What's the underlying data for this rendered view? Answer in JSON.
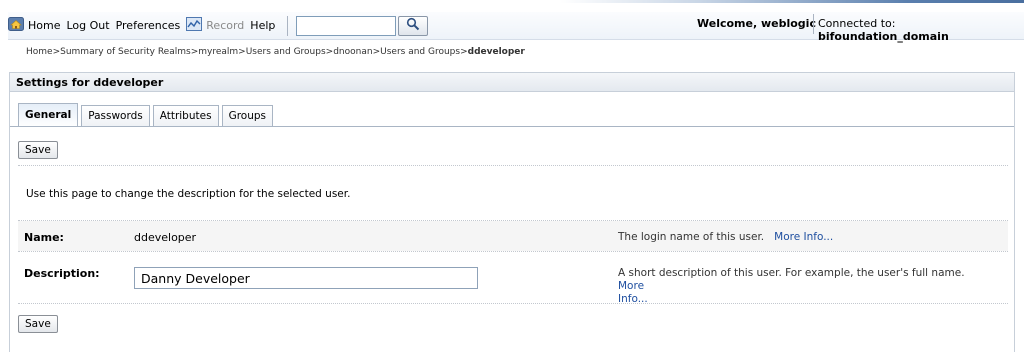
{
  "toolbar": {
    "home": "Home",
    "logout": "Log Out",
    "preferences": "Preferences",
    "record": "Record",
    "help": "Help",
    "search_value": "",
    "icons": {
      "home": "home-icon",
      "record": "record-icon",
      "search": "search-icon"
    }
  },
  "header": {
    "welcome": "Welcome, weblogic",
    "connected_label": "Connected to:",
    "domain": "bifoundation_domain"
  },
  "breadcrumb": {
    "items": [
      "Home",
      "Summary of Security Realms",
      "myrealm",
      "Users and Groups",
      "dnoonan",
      "Users and Groups"
    ],
    "separator": ">",
    "current": "ddeveloper"
  },
  "panel": {
    "title": "Settings for ddeveloper",
    "tabs": [
      {
        "label": "General",
        "active": true
      },
      {
        "label": "Passwords",
        "active": false
      },
      {
        "label": "Attributes",
        "active": false
      },
      {
        "label": "Groups",
        "active": false
      }
    ],
    "save_label": "Save",
    "intro": "Use this page to change the description for the selected user.",
    "fields": {
      "name_label": "Name:",
      "name_value": "ddeveloper",
      "name_help": "The login name of this user.",
      "description_label": "Description:",
      "description_value": "Danny Developer",
      "description_help": "A short description of this user. For example, the user's full name.",
      "more_info": "More Info...",
      "more_info_split_1": "More",
      "more_info_split_2": "Info..."
    }
  },
  "colors": {
    "accent": "#5a7fae",
    "link": "#1f4fa0"
  }
}
